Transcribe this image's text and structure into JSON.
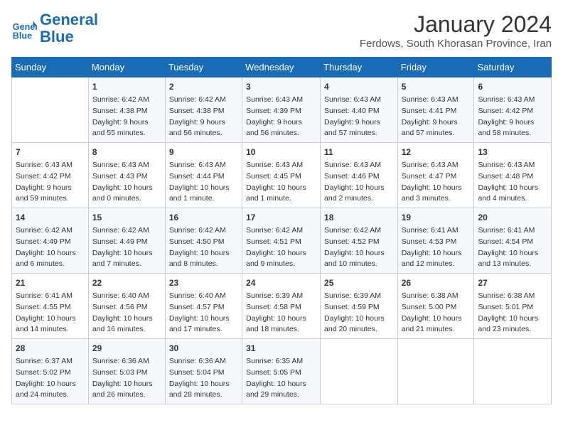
{
  "header": {
    "logo_line1": "General",
    "logo_line2": "Blue",
    "month": "January 2024",
    "location": "Ferdows, South Khorasan Province, Iran"
  },
  "weekdays": [
    "Sunday",
    "Monday",
    "Tuesday",
    "Wednesday",
    "Thursday",
    "Friday",
    "Saturday"
  ],
  "weeks": [
    [
      {
        "day": "",
        "sunrise": "",
        "sunset": "",
        "daylight": ""
      },
      {
        "day": "1",
        "sunrise": "Sunrise: 6:42 AM",
        "sunset": "Sunset: 4:38 PM",
        "daylight": "Daylight: 9 hours and 55 minutes."
      },
      {
        "day": "2",
        "sunrise": "Sunrise: 6:42 AM",
        "sunset": "Sunset: 4:38 PM",
        "daylight": "Daylight: 9 hours and 56 minutes."
      },
      {
        "day": "3",
        "sunrise": "Sunrise: 6:43 AM",
        "sunset": "Sunset: 4:39 PM",
        "daylight": "Daylight: 9 hours and 56 minutes."
      },
      {
        "day": "4",
        "sunrise": "Sunrise: 6:43 AM",
        "sunset": "Sunset: 4:40 PM",
        "daylight": "Daylight: 9 hours and 57 minutes."
      },
      {
        "day": "5",
        "sunrise": "Sunrise: 6:43 AM",
        "sunset": "Sunset: 4:41 PM",
        "daylight": "Daylight: 9 hours and 57 minutes."
      },
      {
        "day": "6",
        "sunrise": "Sunrise: 6:43 AM",
        "sunset": "Sunset: 4:42 PM",
        "daylight": "Daylight: 9 hours and 58 minutes."
      }
    ],
    [
      {
        "day": "7",
        "sunrise": "Sunrise: 6:43 AM",
        "sunset": "Sunset: 4:42 PM",
        "daylight": "Daylight: 9 hours and 59 minutes."
      },
      {
        "day": "8",
        "sunrise": "Sunrise: 6:43 AM",
        "sunset": "Sunset: 4:43 PM",
        "daylight": "Daylight: 10 hours and 0 minutes."
      },
      {
        "day": "9",
        "sunrise": "Sunrise: 6:43 AM",
        "sunset": "Sunset: 4:44 PM",
        "daylight": "Daylight: 10 hours and 1 minute."
      },
      {
        "day": "10",
        "sunrise": "Sunrise: 6:43 AM",
        "sunset": "Sunset: 4:45 PM",
        "daylight": "Daylight: 10 hours and 1 minute."
      },
      {
        "day": "11",
        "sunrise": "Sunrise: 6:43 AM",
        "sunset": "Sunset: 4:46 PM",
        "daylight": "Daylight: 10 hours and 2 minutes."
      },
      {
        "day": "12",
        "sunrise": "Sunrise: 6:43 AM",
        "sunset": "Sunset: 4:47 PM",
        "daylight": "Daylight: 10 hours and 3 minutes."
      },
      {
        "day": "13",
        "sunrise": "Sunrise: 6:43 AM",
        "sunset": "Sunset: 4:48 PM",
        "daylight": "Daylight: 10 hours and 4 minutes."
      }
    ],
    [
      {
        "day": "14",
        "sunrise": "Sunrise: 6:42 AM",
        "sunset": "Sunset: 4:49 PM",
        "daylight": "Daylight: 10 hours and 6 minutes."
      },
      {
        "day": "15",
        "sunrise": "Sunrise: 6:42 AM",
        "sunset": "Sunset: 4:49 PM",
        "daylight": "Daylight: 10 hours and 7 minutes."
      },
      {
        "day": "16",
        "sunrise": "Sunrise: 6:42 AM",
        "sunset": "Sunset: 4:50 PM",
        "daylight": "Daylight: 10 hours and 8 minutes."
      },
      {
        "day": "17",
        "sunrise": "Sunrise: 6:42 AM",
        "sunset": "Sunset: 4:51 PM",
        "daylight": "Daylight: 10 hours and 9 minutes."
      },
      {
        "day": "18",
        "sunrise": "Sunrise: 6:42 AM",
        "sunset": "Sunset: 4:52 PM",
        "daylight": "Daylight: 10 hours and 10 minutes."
      },
      {
        "day": "19",
        "sunrise": "Sunrise: 6:41 AM",
        "sunset": "Sunset: 4:53 PM",
        "daylight": "Daylight: 10 hours and 12 minutes."
      },
      {
        "day": "20",
        "sunrise": "Sunrise: 6:41 AM",
        "sunset": "Sunset: 4:54 PM",
        "daylight": "Daylight: 10 hours and 13 minutes."
      }
    ],
    [
      {
        "day": "21",
        "sunrise": "Sunrise: 6:41 AM",
        "sunset": "Sunset: 4:55 PM",
        "daylight": "Daylight: 10 hours and 14 minutes."
      },
      {
        "day": "22",
        "sunrise": "Sunrise: 6:40 AM",
        "sunset": "Sunset: 4:56 PM",
        "daylight": "Daylight: 10 hours and 16 minutes."
      },
      {
        "day": "23",
        "sunrise": "Sunrise: 6:40 AM",
        "sunset": "Sunset: 4:57 PM",
        "daylight": "Daylight: 10 hours and 17 minutes."
      },
      {
        "day": "24",
        "sunrise": "Sunrise: 6:39 AM",
        "sunset": "Sunset: 4:58 PM",
        "daylight": "Daylight: 10 hours and 18 minutes."
      },
      {
        "day": "25",
        "sunrise": "Sunrise: 6:39 AM",
        "sunset": "Sunset: 4:59 PM",
        "daylight": "Daylight: 10 hours and 20 minutes."
      },
      {
        "day": "26",
        "sunrise": "Sunrise: 6:38 AM",
        "sunset": "Sunset: 5:00 PM",
        "daylight": "Daylight: 10 hours and 21 minutes."
      },
      {
        "day": "27",
        "sunrise": "Sunrise: 6:38 AM",
        "sunset": "Sunset: 5:01 PM",
        "daylight": "Daylight: 10 hours and 23 minutes."
      }
    ],
    [
      {
        "day": "28",
        "sunrise": "Sunrise: 6:37 AM",
        "sunset": "Sunset: 5:02 PM",
        "daylight": "Daylight: 10 hours and 24 minutes."
      },
      {
        "day": "29",
        "sunrise": "Sunrise: 6:36 AM",
        "sunset": "Sunset: 5:03 PM",
        "daylight": "Daylight: 10 hours and 26 minutes."
      },
      {
        "day": "30",
        "sunrise": "Sunrise: 6:36 AM",
        "sunset": "Sunset: 5:04 PM",
        "daylight": "Daylight: 10 hours and 28 minutes."
      },
      {
        "day": "31",
        "sunrise": "Sunrise: 6:35 AM",
        "sunset": "Sunset: 5:05 PM",
        "daylight": "Daylight: 10 hours and 29 minutes."
      },
      {
        "day": "",
        "sunrise": "",
        "sunset": "",
        "daylight": ""
      },
      {
        "day": "",
        "sunrise": "",
        "sunset": "",
        "daylight": ""
      },
      {
        "day": "",
        "sunrise": "",
        "sunset": "",
        "daylight": ""
      }
    ]
  ]
}
